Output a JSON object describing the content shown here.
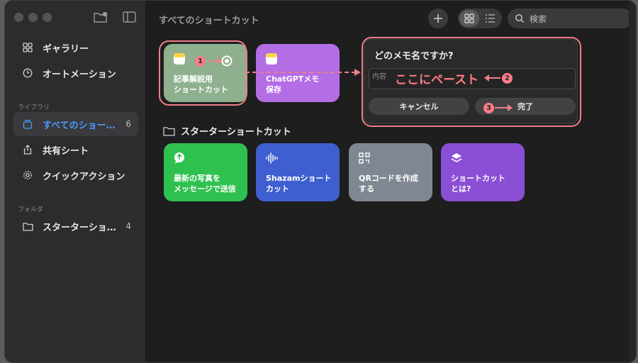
{
  "window": {
    "title": "すべてのショートカット"
  },
  "sidebar": {
    "items": [
      {
        "label": "ギャラリー",
        "icon": "grid-icon"
      },
      {
        "label": "オートメーション",
        "icon": "clock-icon"
      }
    ],
    "library_header": "ライブラリ",
    "library_items": [
      {
        "label": "すべてのショー…",
        "count": "6",
        "icon": "stack-icon",
        "selected": true
      },
      {
        "label": "共有シート",
        "icon": "share-icon"
      },
      {
        "label": "クイックアクション",
        "icon": "gear-icon"
      }
    ],
    "folder_header": "フォルダ",
    "folder_items": [
      {
        "label": "スターターショ…",
        "count": "4",
        "icon": "folder-icon"
      }
    ]
  },
  "toolbar": {
    "search_placeholder": "検索"
  },
  "shortcuts": [
    {
      "label": "記事解説用\nショートカット",
      "color": "#8fb08f",
      "icon": "note-icon"
    },
    {
      "label": "ChatGPTメモ\n保存",
      "color": "#b36ee6",
      "icon": "note-icon"
    }
  ],
  "starter_section": {
    "title": "スターターショートカット"
  },
  "starter_shortcuts": [
    {
      "label": "最新の写真を\nメッセージで送信",
      "color": "#2fc14f",
      "icon": "message-icon"
    },
    {
      "label": "Shazamショート\nカット",
      "color": "#3f5fd0",
      "icon": "waveform-icon"
    },
    {
      "label": "QRコードを作成\nする",
      "color": "#7f8892",
      "icon": "qr-icon"
    },
    {
      "label": "ショートカット\nとは?",
      "color": "#8a4fd4",
      "icon": "layers-icon"
    }
  ],
  "dialog": {
    "title": "どのメモ名ですか?",
    "input_placeholder": "内容",
    "cancel_label": "キャンセル",
    "done_label": "完了"
  },
  "annotations": {
    "paste_here": "ここにペースト",
    "step1": "1",
    "step2": "2",
    "step3": "3",
    "color": "#f07e86"
  }
}
